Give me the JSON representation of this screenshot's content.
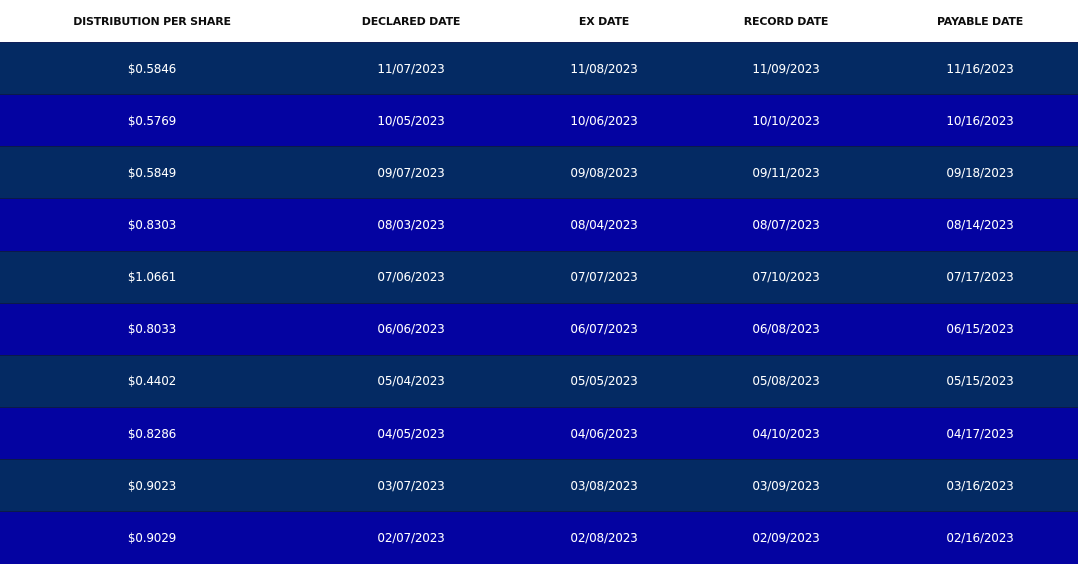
{
  "colors": {
    "header_bg": "#ffffff",
    "header_text": "#0d0d0d",
    "row_dark": "#042a63",
    "row_blue": "#0403a1",
    "cell_text": "#ffffff"
  },
  "table": {
    "headers": {
      "distribution": "DISTRIBUTION PER SHARE",
      "declared": "DECLARED DATE",
      "ex": "EX DATE",
      "record": "RECORD DATE",
      "payable": "PAYABLE DATE"
    },
    "rows": [
      {
        "distribution": "$0.5846",
        "declared": "11/07/2023",
        "ex": "11/08/2023",
        "record": "11/09/2023",
        "payable": "11/16/2023"
      },
      {
        "distribution": "$0.5769",
        "declared": "10/05/2023",
        "ex": "10/06/2023",
        "record": "10/10/2023",
        "payable": "10/16/2023"
      },
      {
        "distribution": "$0.5849",
        "declared": "09/07/2023",
        "ex": "09/08/2023",
        "record": "09/11/2023",
        "payable": "09/18/2023"
      },
      {
        "distribution": "$0.8303",
        "declared": "08/03/2023",
        "ex": "08/04/2023",
        "record": "08/07/2023",
        "payable": "08/14/2023"
      },
      {
        "distribution": "$1.0661",
        "declared": "07/06/2023",
        "ex": "07/07/2023",
        "record": "07/10/2023",
        "payable": "07/17/2023"
      },
      {
        "distribution": "$0.8033",
        "declared": "06/06/2023",
        "ex": "06/07/2023",
        "record": "06/08/2023",
        "payable": "06/15/2023"
      },
      {
        "distribution": "$0.4402",
        "declared": "05/04/2023",
        "ex": "05/05/2023",
        "record": "05/08/2023",
        "payable": "05/15/2023"
      },
      {
        "distribution": "$0.8286",
        "declared": "04/05/2023",
        "ex": "04/06/2023",
        "record": "04/10/2023",
        "payable": "04/17/2023"
      },
      {
        "distribution": "$0.9023",
        "declared": "03/07/2023",
        "ex": "03/08/2023",
        "record": "03/09/2023",
        "payable": "03/16/2023"
      },
      {
        "distribution": "$0.9029",
        "declared": "02/07/2023",
        "ex": "02/08/2023",
        "record": "02/09/2023",
        "payable": "02/16/2023"
      }
    ]
  }
}
